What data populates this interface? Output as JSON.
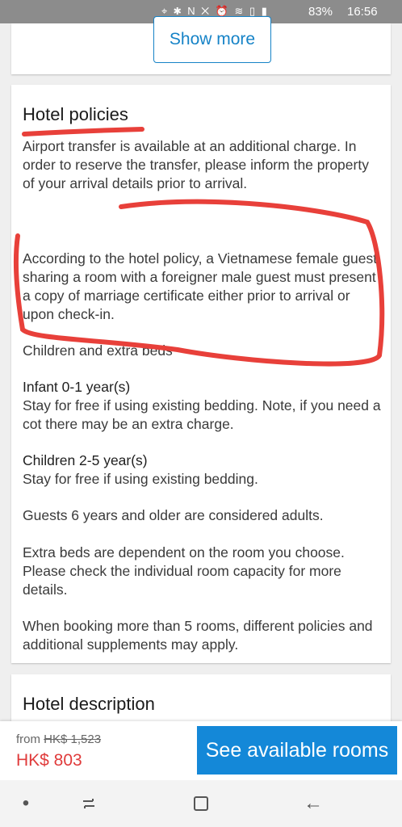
{
  "status_bar": {
    "icons": "⌖ ✱ N ✕ ⏰ ≋ ▯ ▮",
    "battery": "83%",
    "time": "16:56"
  },
  "show_more_label": "Show more",
  "policies": {
    "title": "Hotel policies",
    "airport": "Airport transfer is available at an additional charge. In order to reserve the transfer, please inform the property of your arrival details prior to arrival.",
    "vietnamese": "According to the hotel policy, a Vietnamese female guest sharing a room with a foreigner male guest must present a copy of marriage certificate either prior to arrival or upon check-in.",
    "children_heading": "Children and extra beds",
    "infant_heading": "Infant 0-1 year(s)",
    "infant_text": "Stay for free if using existing bedding. Note, if you need a cot there may be an extra charge.",
    "children_heading2": "Children 2-5 year(s)",
    "children_text": "Stay for free if using existing bedding.",
    "adults_text": "Guests 6 years and older are considered adults.",
    "extra_beds_text": "Extra beds are dependent on the room you choose. Please check the individual room capacity for more details.",
    "rooms_text": "When booking more than 5 rooms, different policies and additional supplements may apply."
  },
  "description": {
    "title": "Hotel description"
  },
  "booking": {
    "from_label": "from",
    "old_price": "HK$ 1,523",
    "price": "HK$ 803",
    "cta_label": "See available rooms"
  },
  "nav": {
    "recent": "•",
    "back_symbol": "←"
  },
  "colors": {
    "accent": "#1683c7",
    "cta": "#1488d8",
    "price": "#e03b3b",
    "annotation": "#e8403a"
  }
}
